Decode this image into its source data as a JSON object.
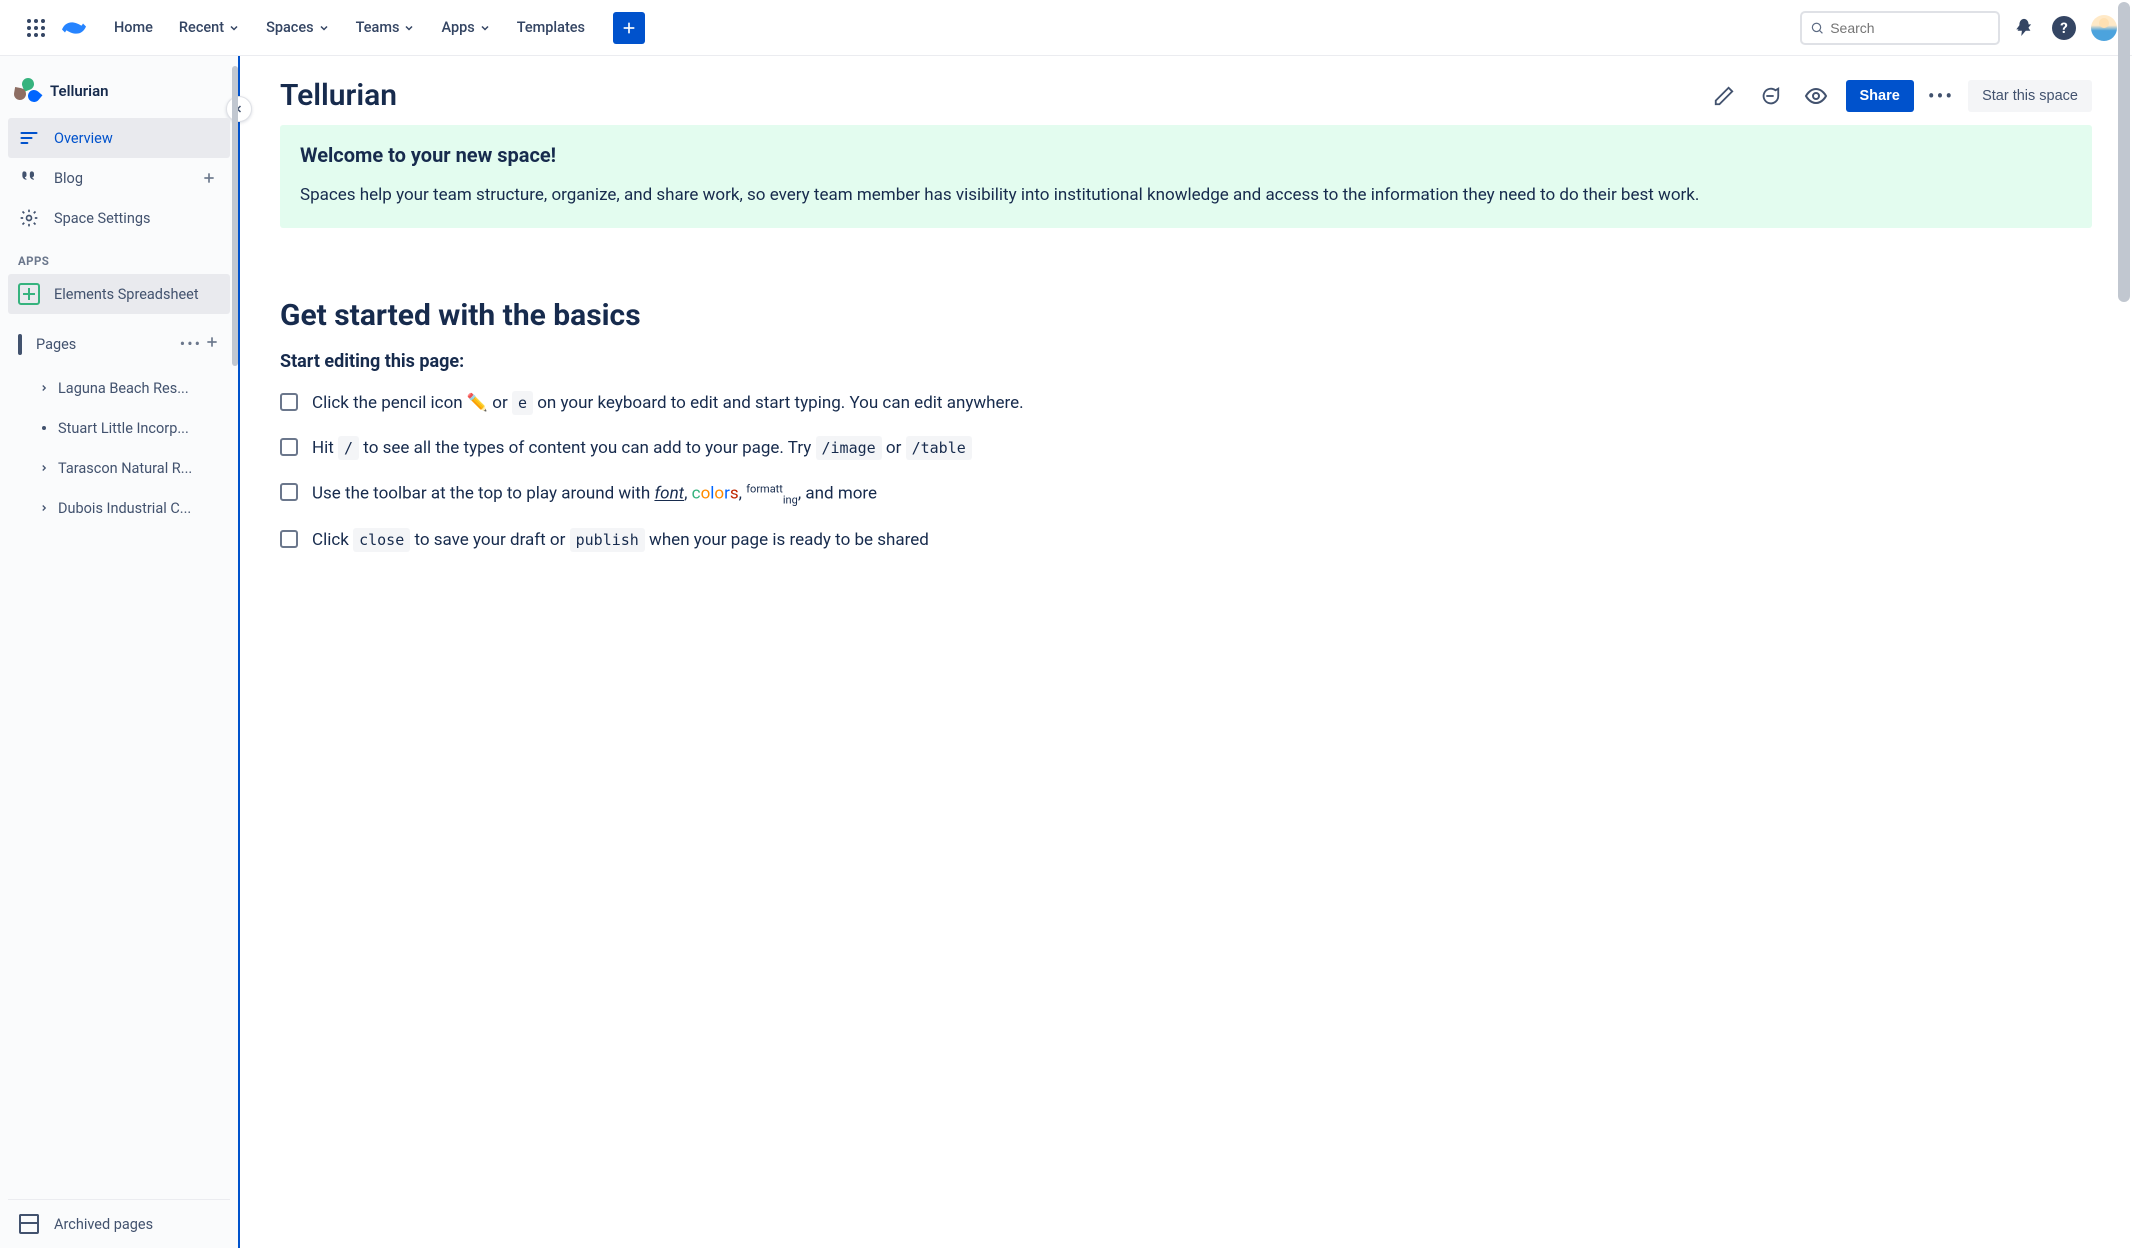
{
  "nav": {
    "home": "Home",
    "recent": "Recent",
    "spaces": "Spaces",
    "teams": "Teams",
    "apps": "Apps",
    "templates": "Templates",
    "search_placeholder": "Search"
  },
  "sidebar": {
    "space_name": "Tellurian",
    "overview": "Overview",
    "blog": "Blog",
    "settings": "Space Settings",
    "apps_label": "APPS",
    "app_item": "Elements Spreadsheet",
    "pages_label": "Pages",
    "pages": [
      {
        "label": "Laguna Beach Res...",
        "expandable": true
      },
      {
        "label": "Stuart Little Incorp...",
        "expandable": false
      },
      {
        "label": "Tarascon Natural R...",
        "expandable": true
      },
      {
        "label": "Dubois Industrial C...",
        "expandable": true
      }
    ],
    "archived": "Archived pages"
  },
  "page": {
    "title": "Tellurian",
    "share": "Share",
    "star": "Star this space",
    "panel_title": "Welcome to your new space!",
    "panel_text": "Spaces help your team structure, organize, and share work, so every team member has visibility into institutional knowledge and access to the information they need to do their best work.",
    "section_title": "Get started with the basics",
    "sub_title": "Start editing this page:",
    "task1_a": "Click the pencil icon ✏️ or ",
    "task1_key": "e",
    "task1_b": " on your keyboard to edit and start typing. You can edit anywhere.",
    "task2_a": "Hit ",
    "task2_key1": "/",
    "task2_b": " to see all the types of content you can add to your page. Try ",
    "task2_key2": "/image",
    "task2_c": " or ",
    "task2_key3": "/table",
    "task3": "Use the toolbar at the top to play around with ",
    "task3_font": "font",
    "task3_comma": ", ",
    "task3_comma2": ", ",
    "task3_end": ", and more",
    "task4_a": "Click ",
    "task4_key1": "close",
    "task4_b": " to save your draft or ",
    "task4_key2": "publish",
    "task4_c": " when your page is ready to be shared"
  }
}
